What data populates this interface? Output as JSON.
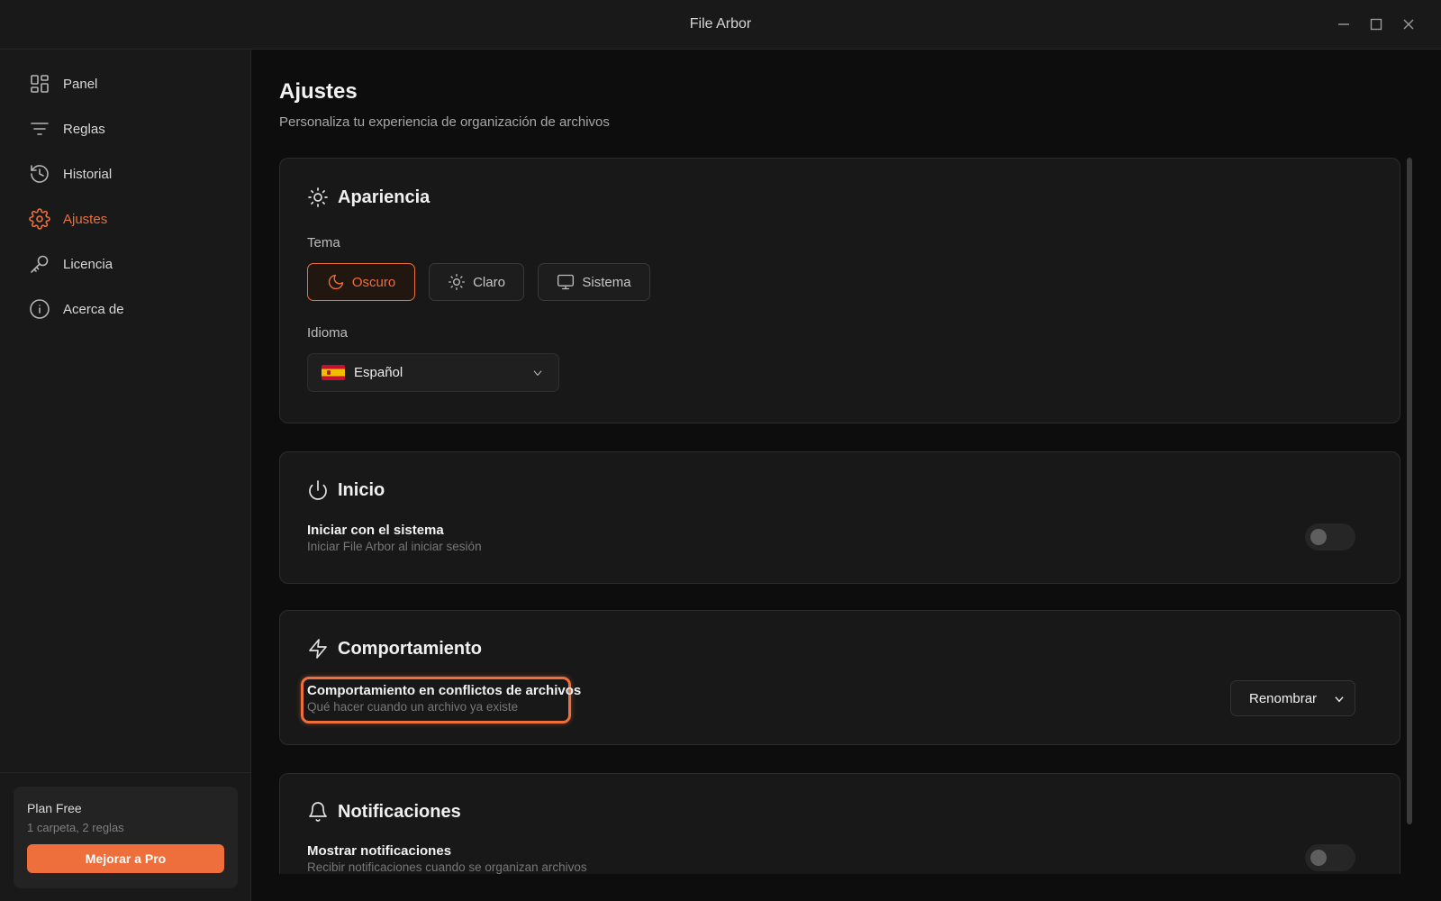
{
  "window": {
    "title": "File Arbor"
  },
  "sidebar": {
    "items": [
      {
        "label": "Panel",
        "icon": "grid-icon",
        "active": false
      },
      {
        "label": "Reglas",
        "icon": "filter-icon",
        "active": false
      },
      {
        "label": "Historial",
        "icon": "history-icon",
        "active": false
      },
      {
        "label": "Ajustes",
        "icon": "gear-icon",
        "active": true
      },
      {
        "label": "Licencia",
        "icon": "key-icon",
        "active": false
      },
      {
        "label": "Acerca de",
        "icon": "info-icon",
        "active": false
      }
    ],
    "plan": {
      "title": "Plan Free",
      "subtitle": "1 carpeta, 2 reglas",
      "upgrade_label": "Mejorar a Pro"
    }
  },
  "page": {
    "title": "Ajustes",
    "subtitle": "Personaliza tu experiencia de organización de archivos"
  },
  "appearance": {
    "title": "Apariencia",
    "theme_label": "Tema",
    "themes": [
      {
        "label": "Oscuro",
        "icon": "moon-icon",
        "selected": true
      },
      {
        "label": "Claro",
        "icon": "sun-icon",
        "selected": false
      },
      {
        "label": "Sistema",
        "icon": "monitor-icon",
        "selected": false
      }
    ],
    "language_label": "Idioma",
    "language_value": "Español",
    "language_flag": "spain-flag-icon"
  },
  "startup": {
    "title": "Inicio",
    "launch_title": "Iniciar con el sistema",
    "launch_desc": "Iniciar File Arbor al iniciar sesión",
    "launch_enabled": false
  },
  "behavior": {
    "title": "Comportamiento",
    "conflict_title": "Comportamiento en conflictos de archivos",
    "conflict_desc": "Qué hacer cuando un archivo ya existe",
    "conflict_value": "Renombrar"
  },
  "notifications": {
    "title": "Notificaciones",
    "show_title": "Mostrar notificaciones",
    "show_desc": "Recibir notificaciones cuando se organizan archivos",
    "show_enabled": false
  },
  "colors": {
    "accent": "#ee6f3b",
    "background": "#0d0d0d",
    "card": "#181818",
    "sidebar": "#191919"
  }
}
